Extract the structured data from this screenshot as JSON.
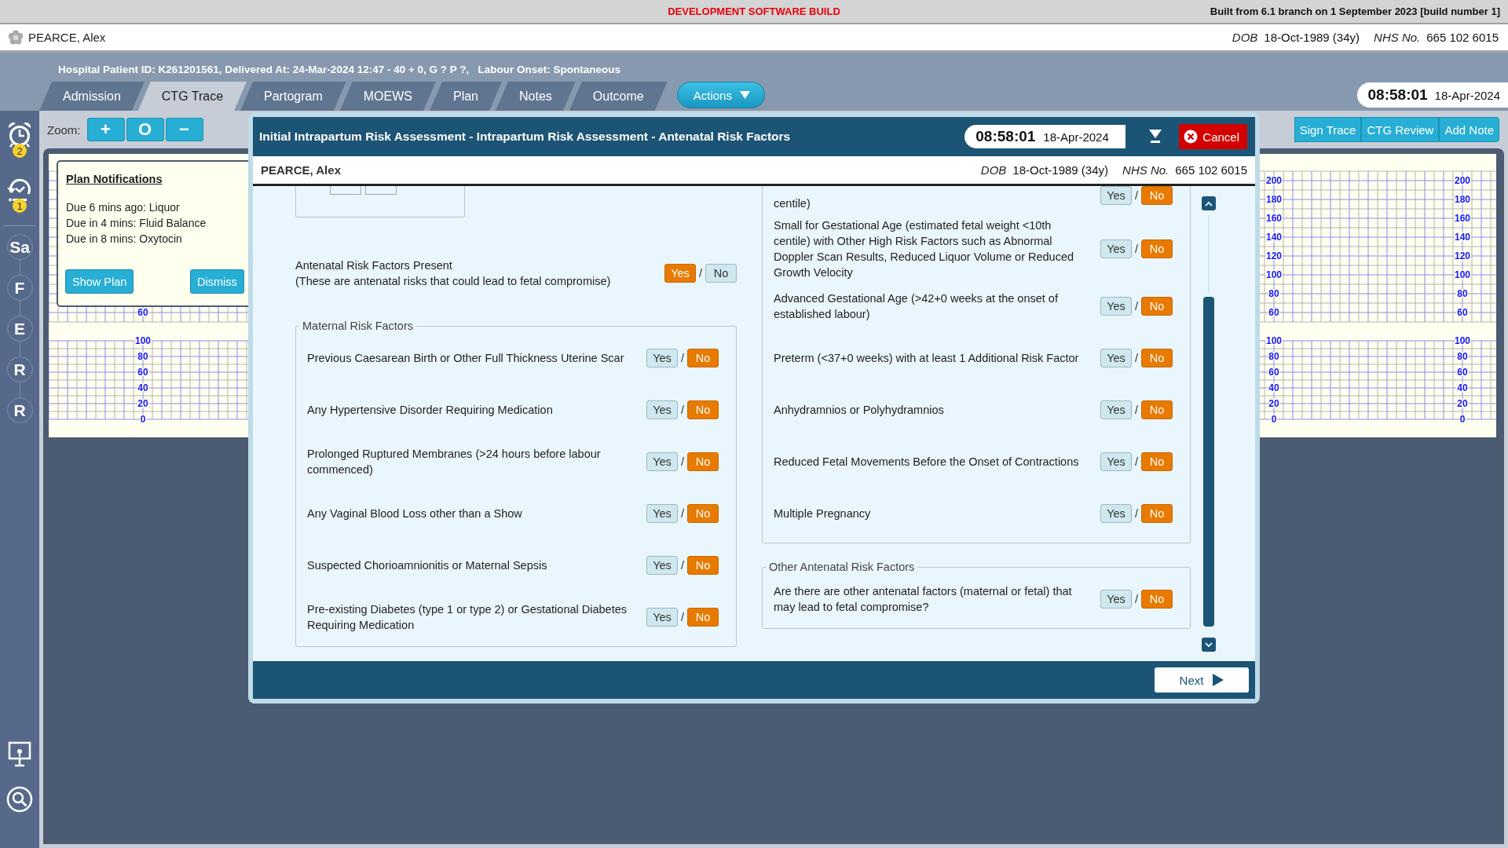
{
  "dev_banner": {
    "title": "DEVELOPMENT SOFTWARE BUILD",
    "build_info": "Built from 6.1 branch on 1 September 2023 [build number 1]"
  },
  "patient_bar": {
    "name": "PEARCE, Alex",
    "dob_label": "DOB",
    "dob": "18-Oct-1989 (34y)",
    "nhs_label": "NHS No.",
    "nhs": "665 102 6015"
  },
  "episode_info": "Hospital Patient ID: K261201561, Delivered At: 24-Mar-2024 12:47 - 40 + 0, G ? P ?,   Labour Onset: Spontaneous",
  "tabs": [
    {
      "label": "Admission",
      "selected": false
    },
    {
      "label": "CTG Trace",
      "selected": true
    },
    {
      "label": "Partogram",
      "selected": false
    },
    {
      "label": "MOEWS",
      "selected": false
    },
    {
      "label": "Plan",
      "selected": false
    },
    {
      "label": "Notes",
      "selected": false
    },
    {
      "label": "Outcome",
      "selected": false
    }
  ],
  "actions_button": "Actions",
  "clock": {
    "time": "08:58:01",
    "date": "18-Apr-2024"
  },
  "sidebar": {
    "alerts": [
      {
        "kind": "alarm",
        "badge": "2"
      },
      {
        "kind": "history",
        "badge": "1"
      }
    ],
    "steps": [
      "Sa",
      "F",
      "E",
      "R",
      "R"
    ],
    "tools": [
      {
        "kind": "board"
      },
      {
        "kind": "search"
      }
    ]
  },
  "toolbar": {
    "zoom_label": "Zoom:",
    "zoom_buttons": [
      "+",
      "O",
      "−"
    ],
    "actions": [
      "Sign Trace",
      "CTG Review",
      "Add Note"
    ]
  },
  "ctg": {
    "scales": [
      {
        "fhr": [
          "60"
        ],
        "toco": [
          "100",
          "80",
          "60",
          "40",
          "20",
          "0"
        ]
      },
      {
        "fhr": [
          "200",
          "180",
          "160",
          "140",
          "120",
          "100",
          "80",
          "60"
        ],
        "toco": [
          "100",
          "80",
          "60",
          "40",
          "20",
          "0"
        ]
      },
      {
        "fhr": [
          "200",
          "180",
          "160",
          "140",
          "120",
          "100",
          "80",
          "60"
        ],
        "toco": [
          "100",
          "80",
          "60",
          "40",
          "20",
          "0"
        ]
      }
    ]
  },
  "plan_notifications": {
    "title": "Plan Notifications",
    "items": [
      "Due 6 mins ago: Liquor",
      "Due in 4 mins: Fluid Balance",
      "Due in 8 mins: Oxytocin"
    ],
    "buttons": [
      "Show Plan",
      "Dismiss"
    ]
  },
  "dialog": {
    "title": "Initial Intrapartum Risk Assessment - Intrapartum Risk Assessment - Antenatal Risk Factors",
    "clock": {
      "time": "08:58:01",
      "date": "18-Apr-2024"
    },
    "cancel": "Cancel",
    "patient": {
      "name": "PEARCE, Alex",
      "dob_label": "DOB",
      "dob": "18-Oct-1989 (34y)",
      "nhs_label": "NHS No.",
      "nhs": "665 102 6015"
    },
    "main_question": {
      "label": "Antenatal Risk Factors Present",
      "hint": "(These are antenatal risks that could lead to fetal compromise)",
      "separator": "/",
      "options": [
        {
          "label": "Yes",
          "selected": true
        },
        {
          "label": "No",
          "selected": false
        }
      ]
    },
    "left_groups": [
      {
        "legend": "Maternal Risk Factors",
        "rows": [
          {
            "label": "Previous Caesarean Birth or Other Full Thickness Uterine Scar",
            "separator": "/",
            "options": [
              {
                "label": "Yes",
                "selected": false
              },
              {
                "label": "No",
                "selected": true
              }
            ]
          },
          {
            "label": "Any Hypertensive Disorder Requiring Medication",
            "separator": "/",
            "options": [
              {
                "label": "Yes",
                "selected": false
              },
              {
                "label": "No",
                "selected": true
              }
            ]
          },
          {
            "label": "Prolonged Ruptured Membranes (>24 hours before labour commenced)",
            "separator": "/",
            "options": [
              {
                "label": "Yes",
                "selected": false
              },
              {
                "label": "No",
                "selected": true
              }
            ]
          },
          {
            "label": "Any Vaginal Blood Loss other than a Show",
            "separator": "/",
            "options": [
              {
                "label": "Yes",
                "selected": false
              },
              {
                "label": "No",
                "selected": true
              }
            ]
          },
          {
            "label": "Suspected Chorioamnionitis or Maternal Sepsis",
            "separator": "/",
            "options": [
              {
                "label": "Yes",
                "selected": false
              },
              {
                "label": "No",
                "selected": true
              }
            ]
          },
          {
            "label": "Pre-existing Diabetes (type 1 or type 2) or Gestational Diabetes Requiring Medication",
            "separator": "/",
            "options": [
              {
                "label": "Yes",
                "selected": false
              },
              {
                "label": "No",
                "selected": true
              }
            ]
          }
        ]
      }
    ],
    "right_groups": [
      {
        "rows": [
          {
            "label": "centile)",
            "separator": "/",
            "options": [
              {
                "label": "Yes",
                "selected": false
              },
              {
                "label": "No",
                "selected": true
              }
            ]
          },
          {
            "label": "Small for Gestational Age (estimated fetal weight <10th centile) with Other High Risk Factors such as Abnormal Doppler Scan Results, Reduced Liquor Volume or Reduced Growth Velocity",
            "separator": "/",
            "options": [
              {
                "label": "Yes",
                "selected": false
              },
              {
                "label": "No",
                "selected": true
              }
            ]
          },
          {
            "label": "Advanced Gestational Age (>42+0 weeks at the onset of established labour)",
            "separator": "/",
            "options": [
              {
                "label": "Yes",
                "selected": false
              },
              {
                "label": "No",
                "selected": true
              }
            ]
          },
          {
            "label": "Preterm (<37+0 weeks) with at least 1 Additional Risk Factor",
            "separator": "/",
            "options": [
              {
                "label": "Yes",
                "selected": false
              },
              {
                "label": "No",
                "selected": true
              }
            ]
          },
          {
            "label": "Anhydramnios or Polyhydramnios",
            "separator": "/",
            "options": [
              {
                "label": "Yes",
                "selected": false
              },
              {
                "label": "No",
                "selected": true
              }
            ]
          },
          {
            "label": "Reduced Fetal Movements Before the Onset of Contractions",
            "separator": "/",
            "options": [
              {
                "label": "Yes",
                "selected": false
              },
              {
                "label": "No",
                "selected": true
              }
            ]
          },
          {
            "label": "Multiple Pregnancy",
            "separator": "/",
            "options": [
              {
                "label": "Yes",
                "selected": false
              },
              {
                "label": "No",
                "selected": true
              }
            ]
          }
        ]
      },
      {
        "legend": "Other Antenatal Risk Factors",
        "rows": [
          {
            "label": "Are there are other antenatal factors (maternal or fetal) that may lead to fetal compromise?",
            "separator": "/",
            "options": [
              {
                "label": "Yes",
                "selected": false
              },
              {
                "label": "No",
                "selected": true
              }
            ]
          }
        ]
      }
    ],
    "next": "Next"
  }
}
